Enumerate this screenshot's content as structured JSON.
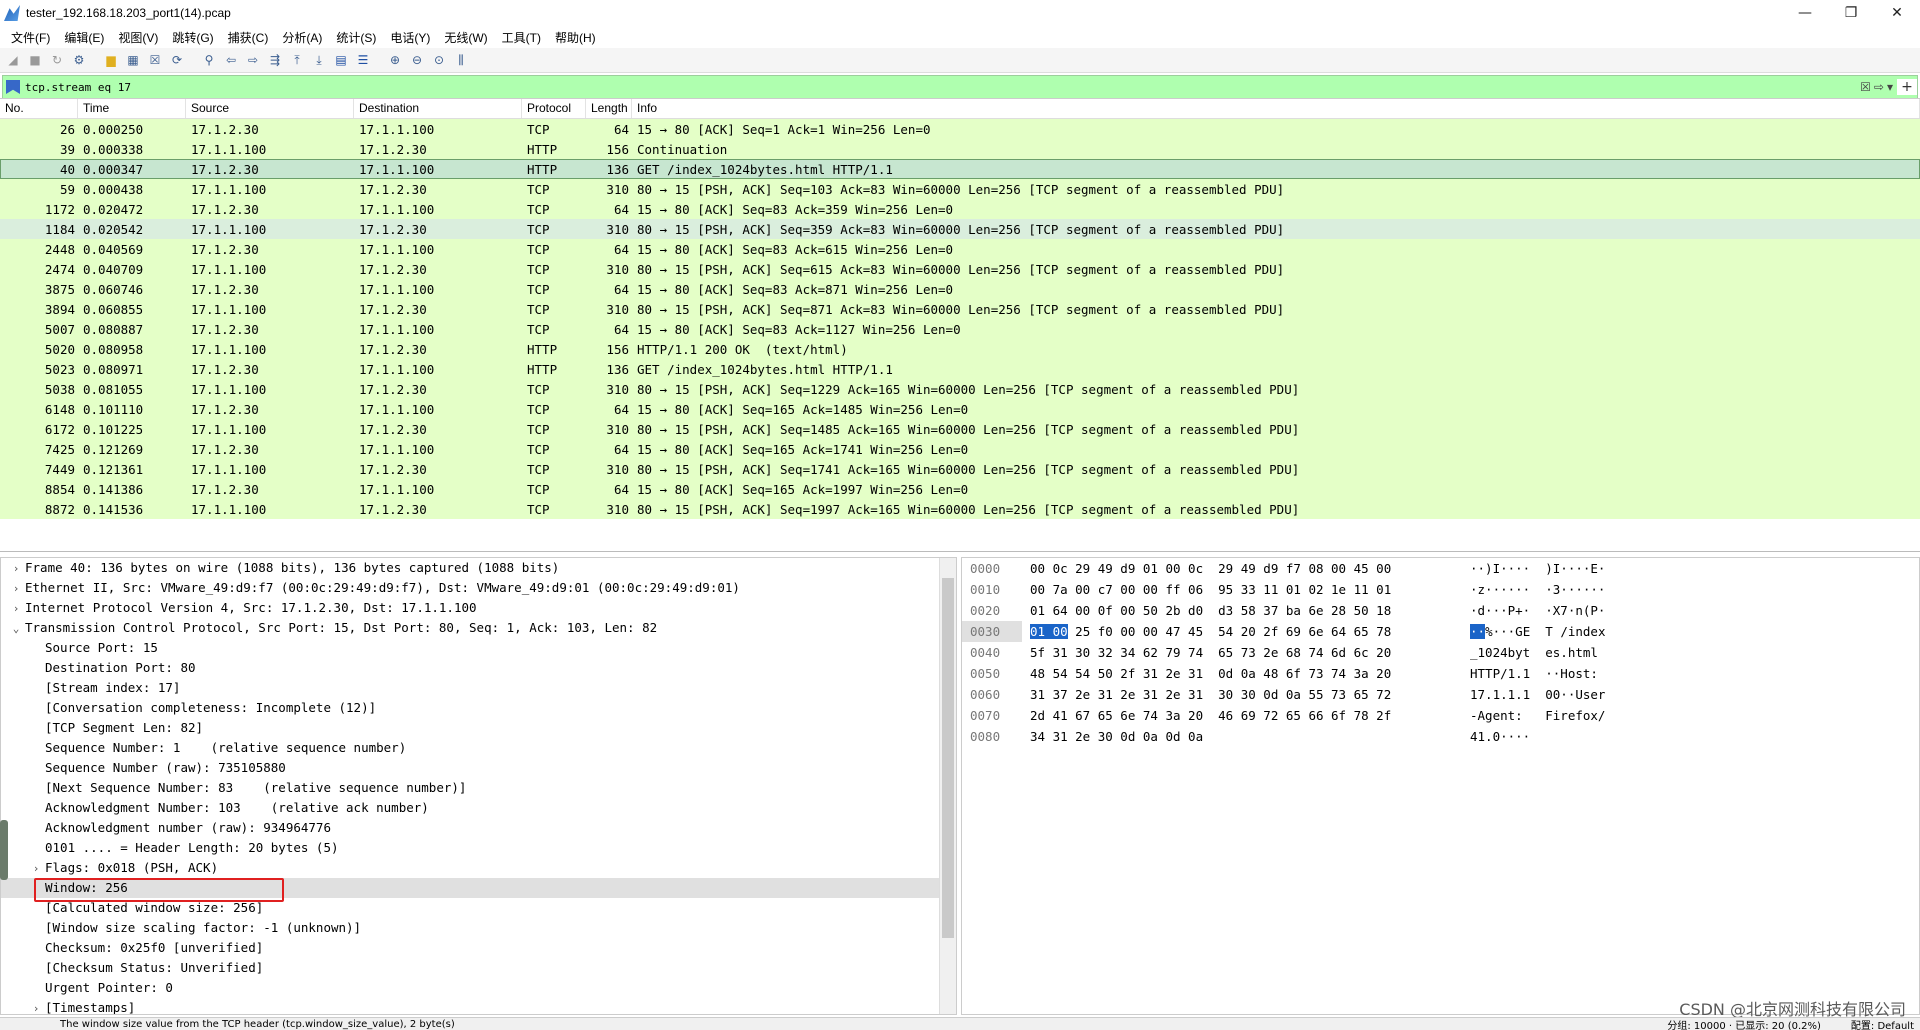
{
  "window": {
    "title": "tester_192.168.18.203_port1(14).pcap",
    "controls": [
      "—",
      "❐",
      "✕"
    ]
  },
  "menu": [
    "文件(F)",
    "编辑(E)",
    "视图(V)",
    "跳转(G)",
    "捕获(C)",
    "分析(A)",
    "统计(S)",
    "电话(Y)",
    "无线(W)",
    "工具(T)",
    "帮助(H)"
  ],
  "filter": {
    "value": "tcp.stream eq 17"
  },
  "columns": [
    "No.",
    "Time",
    "Source",
    "Destination",
    "Protocol",
    "Length",
    "Info"
  ],
  "packets": [
    {
      "no": "26",
      "time": "0.000250",
      "src": "17.1.2.30",
      "dst": "17.1.1.100",
      "proto": "TCP",
      "len": "64",
      "info": "15 → 80 [ACK] Seq=1 Ack=1 Win=256 Len=0"
    },
    {
      "no": "39",
      "time": "0.000338",
      "src": "17.1.1.100",
      "dst": "17.1.2.30",
      "proto": "HTTP",
      "len": "156",
      "info": "Continuation"
    },
    {
      "no": "40",
      "time": "0.000347",
      "src": "17.1.2.30",
      "dst": "17.1.1.100",
      "proto": "HTTP",
      "len": "136",
      "info": "GET /index_1024bytes.html HTTP/1.1"
    },
    {
      "no": "59",
      "time": "0.000438",
      "src": "17.1.1.100",
      "dst": "17.1.2.30",
      "proto": "TCP",
      "len": "310",
      "info": "80 → 15 [PSH, ACK] Seq=103 Ack=83 Win=60000 Len=256 [TCP segment of a reassembled PDU]"
    },
    {
      "no": "1172",
      "time": "0.020472",
      "src": "17.1.2.30",
      "dst": "17.1.1.100",
      "proto": "TCP",
      "len": "64",
      "info": "15 → 80 [ACK] Seq=83 Ack=359 Win=256 Len=0"
    },
    {
      "no": "1184",
      "time": "0.020542",
      "src": "17.1.1.100",
      "dst": "17.1.2.30",
      "proto": "TCP",
      "len": "310",
      "info": "80 → 15 [PSH, ACK] Seq=359 Ack=83 Win=60000 Len=256 [TCP segment of a reassembled PDU]"
    },
    {
      "no": "2448",
      "time": "0.040569",
      "src": "17.1.2.30",
      "dst": "17.1.1.100",
      "proto": "TCP",
      "len": "64",
      "info": "15 → 80 [ACK] Seq=83 Ack=615 Win=256 Len=0"
    },
    {
      "no": "2474",
      "time": "0.040709",
      "src": "17.1.1.100",
      "dst": "17.1.2.30",
      "proto": "TCP",
      "len": "310",
      "info": "80 → 15 [PSH, ACK] Seq=615 Ack=83 Win=60000 Len=256 [TCP segment of a reassembled PDU]"
    },
    {
      "no": "3875",
      "time": "0.060746",
      "src": "17.1.2.30",
      "dst": "17.1.1.100",
      "proto": "TCP",
      "len": "64",
      "info": "15 → 80 [ACK] Seq=83 Ack=871 Win=256 Len=0"
    },
    {
      "no": "3894",
      "time": "0.060855",
      "src": "17.1.1.100",
      "dst": "17.1.2.30",
      "proto": "TCP",
      "len": "310",
      "info": "80 → 15 [PSH, ACK] Seq=871 Ack=83 Win=60000 Len=256 [TCP segment of a reassembled PDU]"
    },
    {
      "no": "5007",
      "time": "0.080887",
      "src": "17.1.2.30",
      "dst": "17.1.1.100",
      "proto": "TCP",
      "len": "64",
      "info": "15 → 80 [ACK] Seq=83 Ack=1127 Win=256 Len=0"
    },
    {
      "no": "5020",
      "time": "0.080958",
      "src": "17.1.1.100",
      "dst": "17.1.2.30",
      "proto": "HTTP",
      "len": "156",
      "info": "HTTP/1.1 200 OK  (text/html)"
    },
    {
      "no": "5023",
      "time": "0.080971",
      "src": "17.1.2.30",
      "dst": "17.1.1.100",
      "proto": "HTTP",
      "len": "136",
      "info": "GET /index_1024bytes.html HTTP/1.1"
    },
    {
      "no": "5038",
      "time": "0.081055",
      "src": "17.1.1.100",
      "dst": "17.1.2.30",
      "proto": "TCP",
      "len": "310",
      "info": "80 → 15 [PSH, ACK] Seq=1229 Ack=165 Win=60000 Len=256 [TCP segment of a reassembled PDU]"
    },
    {
      "no": "6148",
      "time": "0.101110",
      "src": "17.1.2.30",
      "dst": "17.1.1.100",
      "proto": "TCP",
      "len": "64",
      "info": "15 → 80 [ACK] Seq=165 Ack=1485 Win=256 Len=0"
    },
    {
      "no": "6172",
      "time": "0.101225",
      "src": "17.1.1.100",
      "dst": "17.1.2.30",
      "proto": "TCP",
      "len": "310",
      "info": "80 → 15 [PSH, ACK] Seq=1485 Ack=165 Win=60000 Len=256 [TCP segment of a reassembled PDU]"
    },
    {
      "no": "7425",
      "time": "0.121269",
      "src": "17.1.2.30",
      "dst": "17.1.1.100",
      "proto": "TCP",
      "len": "64",
      "info": "15 → 80 [ACK] Seq=165 Ack=1741 Win=256 Len=0"
    },
    {
      "no": "7449",
      "time": "0.121361",
      "src": "17.1.1.100",
      "dst": "17.1.2.30",
      "proto": "TCP",
      "len": "310",
      "info": "80 → 15 [PSH, ACK] Seq=1741 Ack=165 Win=60000 Len=256 [TCP segment of a reassembled PDU]"
    },
    {
      "no": "8854",
      "time": "0.141386",
      "src": "17.1.2.30",
      "dst": "17.1.1.100",
      "proto": "TCP",
      "len": "64",
      "info": "15 → 80 [ACK] Seq=165 Ack=1997 Win=256 Len=0"
    },
    {
      "no": "8872",
      "time": "0.141536",
      "src": "17.1.1.100",
      "dst": "17.1.2.30",
      "proto": "TCP",
      "len": "310",
      "info": "80 → 15 [PSH, ACK] Seq=1997 Ack=165 Win=60000 Len=256 [TCP segment of a reassembled PDU]"
    }
  ],
  "details": [
    {
      "arrow": ">",
      "indent": 0,
      "text": "Frame 40: 136 bytes on wire (1088 bits), 136 bytes captured (1088 bits)"
    },
    {
      "arrow": ">",
      "indent": 0,
      "text": "Ethernet II, Src: VMware_49:d9:f7 (00:0c:29:49:d9:f7), Dst: VMware_49:d9:01 (00:0c:29:49:d9:01)"
    },
    {
      "arrow": ">",
      "indent": 0,
      "text": "Internet Protocol Version 4, Src: 17.1.2.30, Dst: 17.1.1.100"
    },
    {
      "arrow": "v",
      "indent": 0,
      "text": "Transmission Control Protocol, Src Port: 15, Dst Port: 80, Seq: 1, Ack: 103, Len: 82"
    },
    {
      "arrow": "",
      "indent": 1,
      "text": "Source Port: 15"
    },
    {
      "arrow": "",
      "indent": 1,
      "text": "Destination Port: 80"
    },
    {
      "arrow": "",
      "indent": 1,
      "text": "[Stream index: 17]"
    },
    {
      "arrow": "",
      "indent": 1,
      "text": "[Conversation completeness: Incomplete (12)]"
    },
    {
      "arrow": "",
      "indent": 1,
      "text": "[TCP Segment Len: 82]"
    },
    {
      "arrow": "",
      "indent": 1,
      "text": "Sequence Number: 1    (relative sequence number)"
    },
    {
      "arrow": "",
      "indent": 1,
      "text": "Sequence Number (raw): 735105880"
    },
    {
      "arrow": "",
      "indent": 1,
      "text": "[Next Sequence Number: 83    (relative sequence number)]"
    },
    {
      "arrow": "",
      "indent": 1,
      "text": "Acknowledgment Number: 103    (relative ack number)"
    },
    {
      "arrow": "",
      "indent": 1,
      "text": "Acknowledgment number (raw): 934964776"
    },
    {
      "arrow": "",
      "indent": 1,
      "text": "0101 .... = Header Length: 20 bytes (5)"
    },
    {
      "arrow": ">",
      "indent": 1,
      "text": "Flags: 0x018 (PSH, ACK)"
    },
    {
      "arrow": "",
      "indent": 1,
      "text": "Window: 256"
    },
    {
      "arrow": "",
      "indent": 1,
      "text": "[Calculated window size: 256]"
    },
    {
      "arrow": "",
      "indent": 1,
      "text": "[Window size scaling factor: -1 (unknown)]"
    },
    {
      "arrow": "",
      "indent": 1,
      "text": "Checksum: 0x25f0 [unverified]"
    },
    {
      "arrow": "",
      "indent": 1,
      "text": "[Checksum Status: Unverified]"
    },
    {
      "arrow": "",
      "indent": 1,
      "text": "Urgent Pointer: 0"
    },
    {
      "arrow": ">",
      "indent": 1,
      "text": "[Timestamps]"
    }
  ],
  "bytes": [
    {
      "off": "0000",
      "hex": "00 0c 29 49 d9 01 00 0c  29 49 d9 f7 08 00 45 00",
      "ascii": "··)I····  )I····E·"
    },
    {
      "off": "0010",
      "hex": "00 7a 00 c7 00 00 ff 06  95 33 11 01 02 1e 11 01",
      "ascii": "·z······  ·3······"
    },
    {
      "off": "0020",
      "hex": "01 64 00 0f 00 50 2b d0  d3 58 37 ba 6e 28 50 18",
      "ascii": "·d···P+·  ·X7·n(P·"
    },
    {
      "off": "0030",
      "hex_sel": "01 00",
      "hex": " 25 f0 00 00 47 45  54 20 2f 69 6e 64 65 78",
      "ascii_sel": "··",
      "ascii": "%···GE  T /index"
    },
    {
      "off": "0040",
      "hex": "5f 31 30 32 34 62 79 74  65 73 2e 68 74 6d 6c 20",
      "ascii": "_1024byt  es.html "
    },
    {
      "off": "0050",
      "hex": "48 54 54 50 2f 31 2e 31  0d 0a 48 6f 73 74 3a 20",
      "ascii": "HTTP/1.1  ··Host: "
    },
    {
      "off": "0060",
      "hex": "31 37 2e 31 2e 31 2e 31  30 30 0d 0a 55 73 65 72",
      "ascii": "17.1.1.1  00··User"
    },
    {
      "off": "0070",
      "hex": "2d 41 67 65 6e 74 3a 20  46 69 72 65 66 6f 78 2f",
      "ascii": "-Agent:   Firefox/"
    },
    {
      "off": "0080",
      "hex": "34 31 2e 30 0d 0a 0d 0a",
      "ascii": "41.0····"
    }
  ],
  "status": {
    "left": "The window size value from the TCP header (tcp.window_size_value), 2 byte(s)",
    "right": "分组: 10000 · 已显示: 20 (0.2%)",
    "profile": "配置: Default"
  },
  "watermark": "CSDN @北京网测科技有限公司"
}
